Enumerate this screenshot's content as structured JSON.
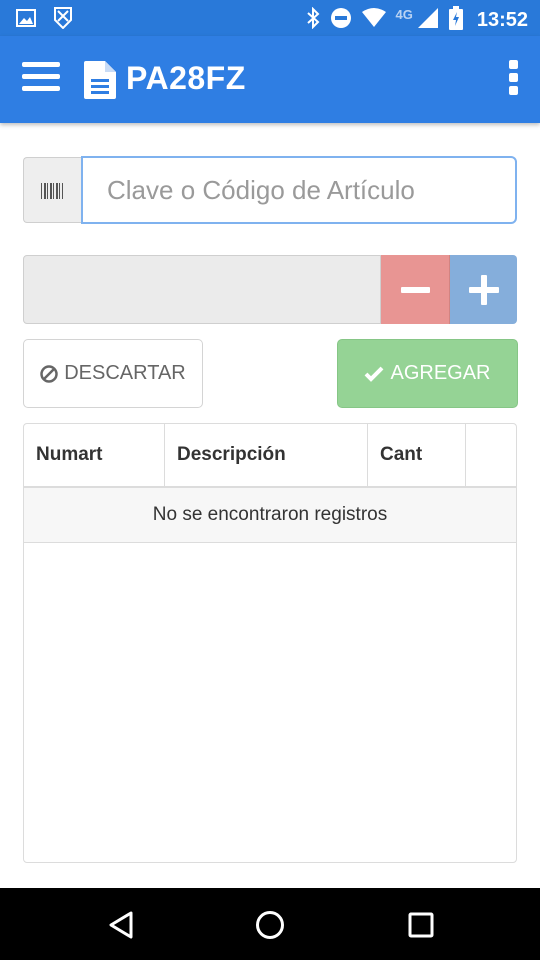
{
  "status_bar": {
    "time": "13:52",
    "network_label": "4G",
    "left_icons": [
      "image-icon",
      "shield-notification-icon"
    ],
    "right_icons": [
      "bluetooth-icon",
      "do-not-disturb-icon",
      "wifi-icon",
      "signal-icon",
      "battery-charging-icon"
    ]
  },
  "app_bar": {
    "title": "PA28FZ",
    "menu_icon": "hamburger-menu-icon",
    "title_icon": "document-icon",
    "overflow_icon": "more-vert-icon",
    "color": "#2f7ee3"
  },
  "search": {
    "placeholder": "Clave o Código de Artículo",
    "value": "",
    "addon_icon": "barcode-icon"
  },
  "quantity": {
    "value": "",
    "minus_icon": "minus-icon",
    "plus_icon": "plus-icon",
    "minus_color": "#e89593",
    "plus_color": "#85aedb"
  },
  "actions": {
    "discard_label": "DESCARTAR",
    "discard_icon": "ban-icon",
    "add_label": "AGREGAR",
    "add_icon": "check-icon",
    "add_color": "#95d395"
  },
  "table": {
    "columns": [
      "Numart",
      "Descripción",
      "Cant",
      ""
    ],
    "empty_message": "No se encontraron registros",
    "rows": []
  },
  "nav_bar": {
    "buttons": [
      "back-icon",
      "home-icon",
      "recents-icon"
    ]
  }
}
